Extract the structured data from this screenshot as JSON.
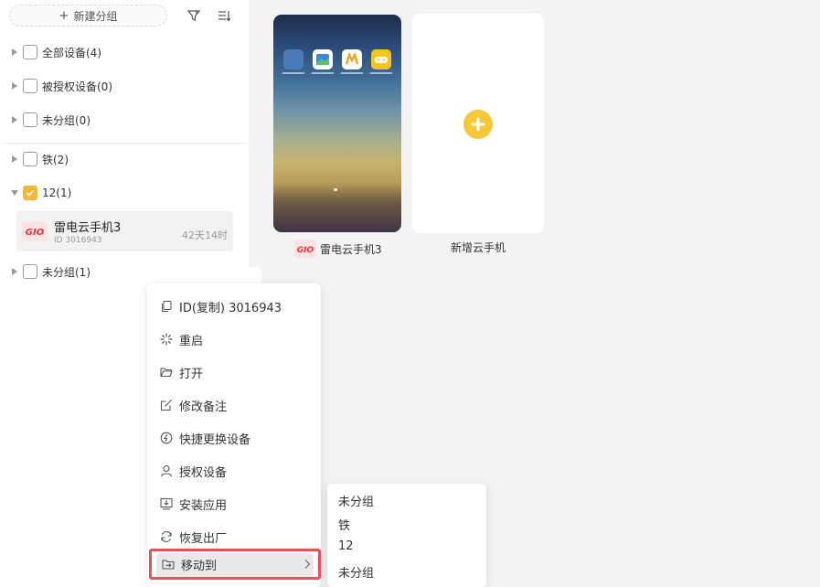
{
  "sidebar": {
    "new_group_label": "新建分组",
    "filter_icon": "filter-icon",
    "sort_icon": "sort-icon",
    "groups_top": [
      {
        "label": "全部设备(4)",
        "checked": false
      },
      {
        "label": "被授权设备(0)",
        "checked": false
      },
      {
        "label": "未分组(0)",
        "checked": false
      }
    ],
    "groups": [
      {
        "label": "铁(2)",
        "checked": false,
        "expanded": false
      },
      {
        "label": "12(1)",
        "checked": true,
        "expanded": true
      },
      {
        "label": "未分组(1)",
        "checked": false,
        "expanded": false
      }
    ],
    "device": {
      "logo_text": "GIO",
      "name": "雷电云手机3",
      "id_text": "ID 3016943",
      "time": "42天14时"
    }
  },
  "main": {
    "phone": {
      "name": "雷电云手机3",
      "logo_text": "GIO"
    },
    "add_card": {
      "label": "新增云手机"
    }
  },
  "context_menu": {
    "items": [
      {
        "label": "ID(复制) 3016943",
        "icon": "copy-icon"
      },
      {
        "label": "重启",
        "icon": "restart-icon"
      },
      {
        "label": "打开",
        "icon": "folder-open-icon"
      },
      {
        "label": "修改备注",
        "icon": "edit-icon"
      },
      {
        "label": "快捷更换设备",
        "icon": "lightning-icon"
      },
      {
        "label": "授权设备",
        "icon": "user-icon"
      },
      {
        "label": "安装应用",
        "icon": "install-icon"
      },
      {
        "label": "恢复出厂",
        "icon": "refresh-icon"
      }
    ],
    "move_to": {
      "label": "移动到",
      "icon": "move-icon"
    }
  },
  "submenu": {
    "items": [
      "未分组",
      "铁",
      "12",
      "未分组"
    ]
  },
  "colors": {
    "accent": "#f5b836",
    "highlight_border": "#e8505b",
    "logo_red": "#e8333b"
  }
}
